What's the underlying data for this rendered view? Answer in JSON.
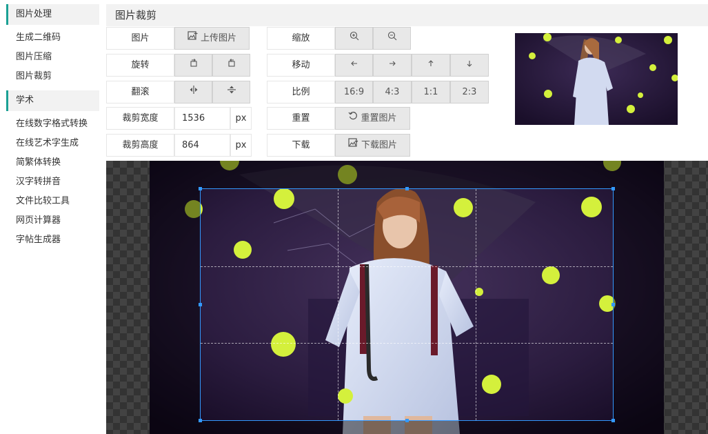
{
  "sidebar": {
    "sections": [
      {
        "label": "图片处理",
        "items": [
          "生成二维码",
          "图片压缩",
          "图片裁剪"
        ]
      },
      {
        "label": "学术",
        "items": [
          "在线数字格式转换",
          "在线艺术字生成",
          "简繁体转换",
          "汉字转拼音",
          "文件比较工具",
          "网页计算器",
          "字帖生成器"
        ]
      }
    ]
  },
  "main": {
    "title": "图片裁剪"
  },
  "controls": {
    "image_label": "图片",
    "upload_label": "上传图片",
    "rotate_label": "旋转",
    "flip_label": "翻滚",
    "crop_width_label": "裁剪宽度",
    "crop_width_value": "1536",
    "crop_height_label": "裁剪高度",
    "crop_height_value": "864",
    "unit": "px",
    "zoom_label": "缩放",
    "move_label": "移动",
    "ratio_label": "比例",
    "ratios": [
      "16:9",
      "4:3",
      "1:1",
      "2:3"
    ],
    "reset_label": "重置",
    "reset_button": "重置图片",
    "download_label": "下载",
    "download_button": "下载图片"
  },
  "colors": {
    "accent": "#1aa094",
    "crop_border": "#3399ff",
    "ball": "#d4f03c"
  }
}
